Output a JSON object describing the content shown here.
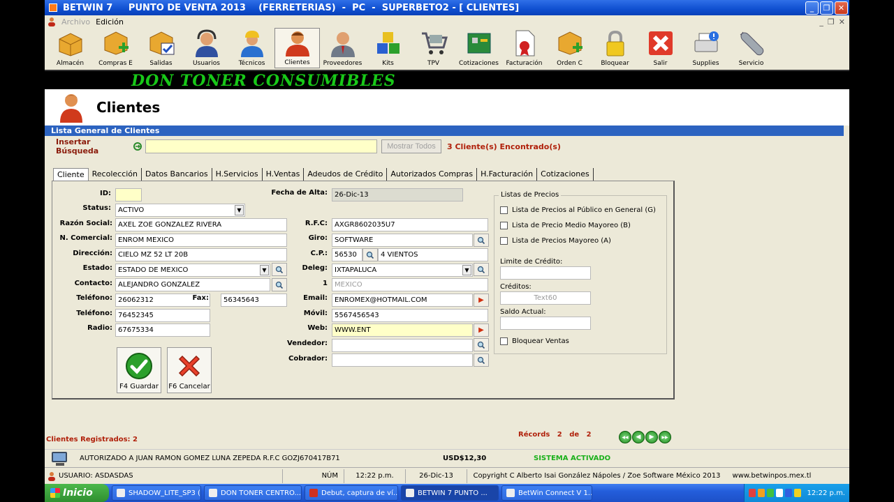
{
  "window": {
    "title": "BETWIN 7     PUNTO DE VENTA 2013    (FERRETERIAS)  -  PC  -  SUPERBETO2 - [ CLIENTES]",
    "min": "_",
    "max": "❐",
    "close": "✕"
  },
  "menu": {
    "archivo": "Archivo",
    "edicion": "Edición",
    "mctrls": [
      "_",
      "❐",
      "✕"
    ]
  },
  "toolbar": [
    {
      "label": "Almacén",
      "icon": "box-icon"
    },
    {
      "label": "Compras E",
      "icon": "box-add-icon"
    },
    {
      "label": "Salidas",
      "icon": "box-check-icon"
    },
    {
      "label": "Usuarios",
      "icon": "user-headset-icon"
    },
    {
      "label": "Técnicos",
      "icon": "worker-icon"
    },
    {
      "label": "Clientes",
      "icon": "client-icon"
    },
    {
      "label": "Proveedores",
      "icon": "supplier-icon"
    },
    {
      "label": "Kits",
      "icon": "kits-icon"
    },
    {
      "label": "TPV",
      "icon": "cart-icon"
    },
    {
      "label": "Cotizaciones",
      "icon": "board-icon"
    },
    {
      "label": "Facturación",
      "icon": "invoice-icon"
    },
    {
      "label": "Orden C",
      "icon": "box-order-icon"
    },
    {
      "label": "Bloquear",
      "icon": "lock-icon"
    },
    {
      "label": "Salir",
      "icon": "exit-icon"
    },
    {
      "label": "Supplies",
      "icon": "printer-icon"
    },
    {
      "label": "Servicio",
      "icon": "wrench-icon"
    }
  ],
  "banner": "DON TONER CONSUMIBLES",
  "page": {
    "title": "Clientes",
    "list_header": "Lista General de Clientes"
  },
  "search": {
    "label": "Insertar Búsqueda",
    "value": "",
    "show_all": "Mostrar Todos",
    "found": "3 Cliente(s) Encontrado(s)"
  },
  "tabs": [
    "Cliente",
    "Recolección",
    "Datos Bancarios",
    "H.Servicios",
    "H.Ventas",
    "Adeudos de Crédito",
    "Autorizados Compras",
    "H.Facturación",
    "Cotizaciones"
  ],
  "form": {
    "id_label": "ID:",
    "id": "",
    "status_label": "Status:",
    "status": "ACTIVO",
    "razon_label": "Razón Social:",
    "razon": "AXEL ZOE GONZALEZ RIVERA",
    "comercial_label": "N. Comercial:",
    "comercial": "ENROM MEXICO",
    "direccion_label": "Dirección:",
    "direccion": "CIELO MZ 52 LT 20B",
    "estado_label": "Estado:",
    "estado": "ESTADO DE MEXICO",
    "contacto_label": "Contacto:",
    "contacto": "ALEJANDRO GONZALEZ",
    "tel1_label": "Teléfono:",
    "tel1": "26062312",
    "fax_label": "Fax:",
    "fax": "56345643",
    "tel2_label": "Teléfono:",
    "tel2": "76452345",
    "radio_label": "Radio:",
    "radio": "67675334",
    "fecha_label": "Fecha de Alta:",
    "fecha": "26-Dic-13",
    "rfc_label": "R.F.C:",
    "rfc": "AXGR8602035U7",
    "giro_label": "Giro:",
    "giro": "SOFTWARE",
    "cp_label": "C.P.:",
    "cp": "56530",
    "colonia": "4 VIENTOS",
    "deleg_label": "Deleg:",
    "deleg": "IXTAPALUCA",
    "pais_label": "1",
    "pais": "MEXICO",
    "email_label": "Email:",
    "email": "ENROMEX@HOTMAIL.COM",
    "movil_label": "Móvil:",
    "movil": "5567456543",
    "web_label": "Web:",
    "web": "WWW.ENT",
    "vendedor_label": "Vendedor:",
    "vendedor": "",
    "cobrador_label": "Cobrador:",
    "cobrador": ""
  },
  "precios": {
    "title": "Listas de Precios",
    "opts": [
      "Lista de Precios al Público en General (G)",
      "Lista de Precio Medio Mayoreo (B)",
      "Lista de Precios Mayoreo  (A)"
    ],
    "limite_label": "Limite de Crédito:",
    "creditos_label": "Créditos:",
    "creditos": "Text60",
    "saldo_label": "Saldo Actual:",
    "bloquear": "Bloquear Ventas"
  },
  "buttons": {
    "guardar": "F4 Guardar",
    "cancelar": "F6 Cancelar"
  },
  "records": {
    "label": "Récords",
    "current": "2",
    "de": "de",
    "total": "2",
    "nav": [
      "◀◀",
      "◀",
      "▶",
      "▶▶"
    ]
  },
  "registered": "Clientes Registrados: 2",
  "auth": {
    "text": "AUTORIZADO A  JUAN RAMON GOMEZ LUNA ZEPEDA R.F.C GOZJ670417B71",
    "usd": "USD$12,30",
    "system": "SISTEMA ACTIVADO"
  },
  "status": {
    "user": "USUARIO: ASDASDAS",
    "num": "NÚM",
    "time": "12:22 p.m.",
    "date": "26-Dic-13",
    "copyright": "Copyright C Alberto Isai González Nápoles / Zoe Software México 2013",
    "web": "www.betwinpos.mex.tl"
  },
  "taskbar": {
    "start": "Inicio",
    "tasks": [
      "SHADOW_LITE_SP3 (...",
      "DON TONER CENTRO...",
      "Debut, captura de ví...",
      "BETWIN 7    PUNTO ...",
      "BetWin Connect  V 1...."
    ],
    "clock": "12:22 p.m."
  },
  "colors": {
    "accent": "#2c63c0",
    "banner_text": "#18c818",
    "found_text": "#b0200a",
    "search_bg": "#ffffc8"
  }
}
